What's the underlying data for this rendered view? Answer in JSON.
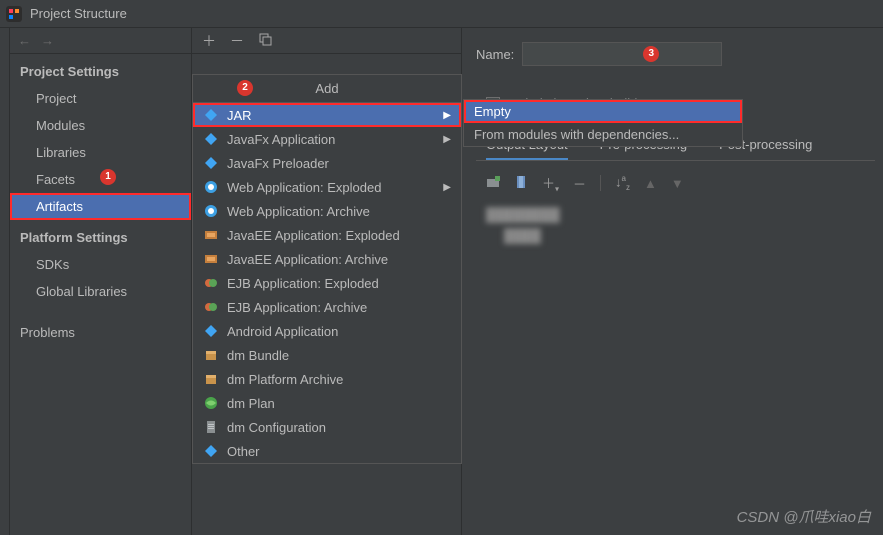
{
  "window": {
    "title": "Project Structure"
  },
  "annotations": {
    "one": "1",
    "two": "2",
    "three": "3"
  },
  "sidebar": {
    "sections": {
      "project": {
        "title": "Project Settings",
        "items": [
          {
            "label": "Project"
          },
          {
            "label": "Modules"
          },
          {
            "label": "Libraries"
          },
          {
            "label": "Facets"
          },
          {
            "label": "Artifacts"
          }
        ]
      },
      "platform": {
        "title": "Platform Settings",
        "items": [
          {
            "label": "SDKs"
          },
          {
            "label": "Global Libraries"
          }
        ]
      },
      "problems": {
        "label": "Problems"
      }
    }
  },
  "artifact_menu": {
    "header": "Add",
    "items": [
      {
        "label": "JAR",
        "arrow": true,
        "icon": "diamond-blue"
      },
      {
        "label": "JavaFx Application",
        "arrow": true,
        "icon": "diamond-blue"
      },
      {
        "label": "JavaFx Preloader",
        "icon": "diamond-blue"
      },
      {
        "label": "Web Application: Exploded",
        "arrow": true,
        "icon": "web"
      },
      {
        "label": "Web Application: Archive",
        "icon": "web"
      },
      {
        "label": "JavaEE Application: Exploded",
        "icon": "javaee"
      },
      {
        "label": "JavaEE Application: Archive",
        "icon": "javaee"
      },
      {
        "label": "EJB Application: Exploded",
        "icon": "ejb"
      },
      {
        "label": "EJB Application: Archive",
        "icon": "ejb"
      },
      {
        "label": "Android Application",
        "icon": "diamond-blue"
      },
      {
        "label": "dm Bundle",
        "icon": "box"
      },
      {
        "label": "dm Platform Archive",
        "icon": "box"
      },
      {
        "label": "dm Plan",
        "icon": "globe"
      },
      {
        "label": "dm Configuration",
        "icon": "file"
      },
      {
        "label": "Other",
        "icon": "diamond-blue"
      }
    ],
    "submenu": {
      "items": [
        {
          "label": "Empty"
        },
        {
          "label": "From modules with dependencies..."
        }
      ]
    }
  },
  "right": {
    "name_label": "Name:",
    "include_label_pre": "Include in project ",
    "include_label_u": "b",
    "include_label_post": "uild",
    "tabs": [
      {
        "label": "Output Layout"
      },
      {
        "label": "Pre-processing"
      },
      {
        "label": "Post-processing"
      }
    ]
  },
  "watermark": "CSDN @爪哇xiao白"
}
